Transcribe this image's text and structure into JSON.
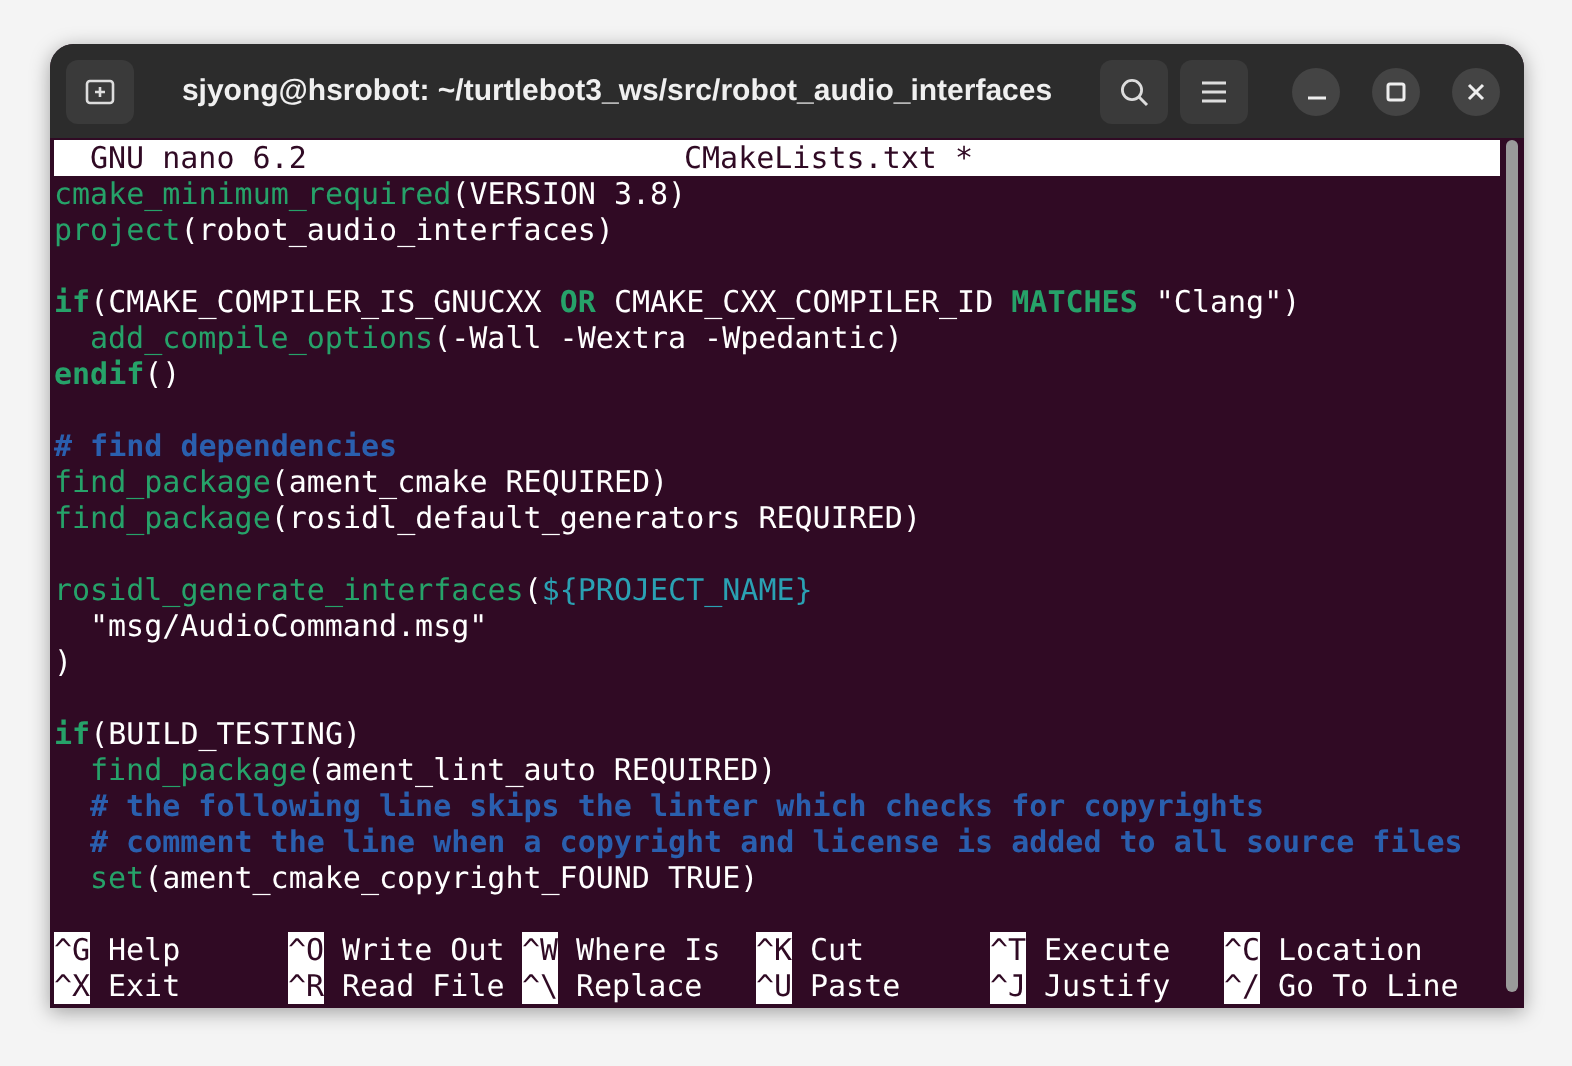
{
  "window": {
    "title": "sjyong@hsrobot: ~/turtlebot3_ws/src/robot_audio_interfaces"
  },
  "nano_header": {
    "version": "GNU nano 6.2",
    "filename": "CMakeLists.txt *"
  },
  "lines": [
    {
      "kind": "code",
      "segments": [
        {
          "kind": "func",
          "text": "cmake_minimum_required"
        },
        {
          "kind": "plain",
          "text": "(VERSION 3.8)"
        }
      ]
    },
    {
      "kind": "code",
      "segments": [
        {
          "kind": "func",
          "text": "project"
        },
        {
          "kind": "plain",
          "text": "(robot_audio_interfaces)"
        }
      ]
    },
    {
      "kind": "blank"
    },
    {
      "kind": "code",
      "segments": [
        {
          "kind": "keyword",
          "text": "if"
        },
        {
          "kind": "plain",
          "text": "(CMAKE_COMPILER_IS_GNUCXX "
        },
        {
          "kind": "keyword",
          "text": "OR"
        },
        {
          "kind": "plain",
          "text": " CMAKE_CXX_COMPILER_ID "
        },
        {
          "kind": "keyword",
          "text": "MATCHES"
        },
        {
          "kind": "plain",
          "text": " \"Clang\")"
        }
      ],
      "children": [
        {
          "kind": "code",
          "segments": [
            {
              "kind": "func",
              "text": "add_compile_options"
            },
            {
              "kind": "plain",
              "text": "(-Wall -Wextra -Wpedantic)"
            }
          ]
        }
      ]
    },
    {
      "kind": "code",
      "segments": [
        {
          "kind": "keyword",
          "text": "endif"
        },
        {
          "kind": "plain",
          "text": "()"
        }
      ]
    },
    {
      "kind": "blank"
    },
    {
      "kind": "code",
      "segments": [
        {
          "kind": "comment",
          "text": "# find dependencies"
        }
      ]
    },
    {
      "kind": "code",
      "segments": [
        {
          "kind": "func",
          "text": "find_package"
        },
        {
          "kind": "plain",
          "text": "(ament_cmake REQUIRED)"
        }
      ]
    },
    {
      "kind": "code",
      "segments": [
        {
          "kind": "func",
          "text": "find_package"
        },
        {
          "kind": "plain",
          "text": "(rosidl_default_generators REQUIRED)"
        }
      ]
    },
    {
      "kind": "blank"
    },
    {
      "kind": "code",
      "segments": [
        {
          "kind": "func",
          "text": "rosidl_generate_interfaces"
        },
        {
          "kind": "plain",
          "text": "("
        },
        {
          "kind": "variable",
          "text": "${PROJECT_NAME}"
        }
      ],
      "children": [
        {
          "kind": "code",
          "segments": [
            {
              "kind": "plain",
              "text": "\"msg/AudioCommand.msg\""
            }
          ]
        }
      ]
    },
    {
      "kind": "code",
      "segments": [
        {
          "kind": "plain",
          "text": ")"
        }
      ]
    },
    {
      "kind": "blank"
    },
    {
      "kind": "code",
      "segments": [
        {
          "kind": "keyword",
          "text": "if"
        },
        {
          "kind": "plain",
          "text": "(BUILD_TESTING)"
        }
      ],
      "children": [
        {
          "kind": "code",
          "segments": [
            {
              "kind": "func",
              "text": "find_package"
            },
            {
              "kind": "plain",
              "text": "(ament_lint_auto REQUIRED)"
            }
          ]
        },
        {
          "kind": "code",
          "segments": [
            {
              "kind": "comment",
              "text": "# the following line skips the linter which checks for copyrights"
            }
          ]
        },
        {
          "kind": "code",
          "segments": [
            {
              "kind": "comment",
              "text": "# comment the line when a copyright and license is added to all source files"
            }
          ]
        },
        {
          "kind": "code",
          "segments": [
            {
              "kind": "func",
              "text": "set"
            },
            {
              "kind": "plain",
              "text": "(ament_cmake_copyright_FOUND TRUE)"
            }
          ]
        }
      ]
    }
  ],
  "shortcuts": [
    [
      {
        "key": "^G",
        "label": "Help"
      },
      {
        "key": "^O",
        "label": "Write Out"
      },
      {
        "key": "^W",
        "label": "Where Is"
      },
      {
        "key": "^K",
        "label": "Cut"
      },
      {
        "key": "^T",
        "label": "Execute"
      },
      {
        "key": "^C",
        "label": "Location"
      }
    ],
    [
      {
        "key": "^X",
        "label": "Exit"
      },
      {
        "key": "^R",
        "label": "Read File"
      },
      {
        "key": "^\\",
        "label": "Replace"
      },
      {
        "key": "^U",
        "label": "Paste"
      },
      {
        "key": "^J",
        "label": "Justify"
      },
      {
        "key": "^/",
        "label": "Go To Line"
      }
    ]
  ]
}
